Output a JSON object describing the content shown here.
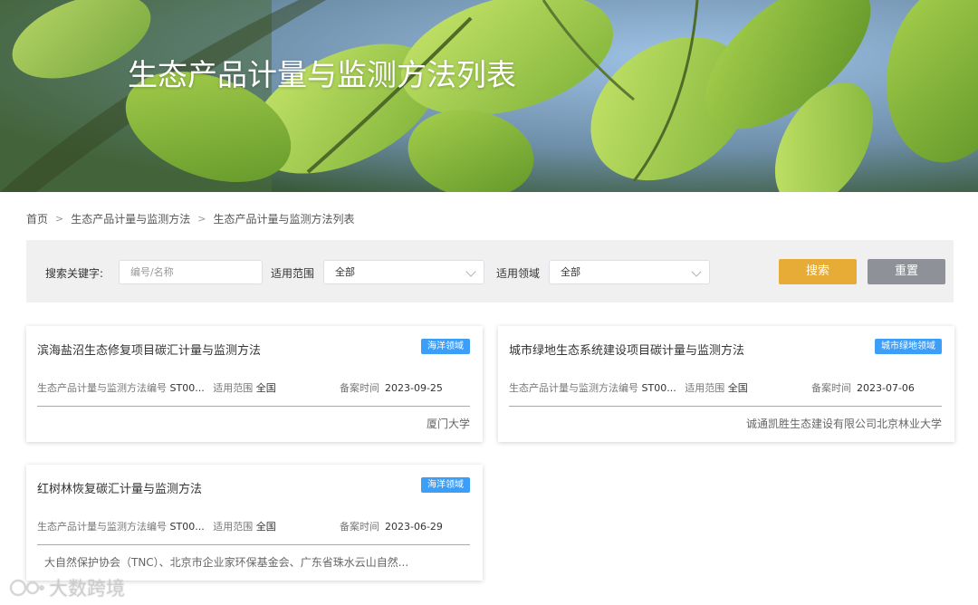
{
  "banner": {
    "title": "生态产品计量与监测方法列表"
  },
  "breadcrumb": {
    "items": [
      "首页",
      "生态产品计量与监测方法",
      "生态产品计量与监测方法列表"
    ]
  },
  "search": {
    "keyword_label": "搜索关键字:",
    "keyword_placeholder": "编号/名称",
    "scope_label": "适用范围",
    "scope_value": "全部",
    "field_label": "适用领域",
    "field_value": "全部",
    "search_button": "搜索",
    "reset_button": "重置"
  },
  "cards": [
    {
      "title": "滨海盐沼生态修复项目碳汇计量与监测方法",
      "tag": "海洋领域",
      "code_label": "生态产品计量与监测方法编号",
      "code_value": "ST00...",
      "scope_label": "适用范围",
      "scope_value": "全国",
      "date_label": "备案时间",
      "date_value": "2023-09-25",
      "org": "厦门大学"
    },
    {
      "title": "城市绿地生态系统建设项目碳计量与监测方法",
      "tag": "城市绿地领域",
      "code_label": "生态产品计量与监测方法编号",
      "code_value": "ST00...",
      "scope_label": "适用范围",
      "scope_value": "全国",
      "date_label": "备案时间",
      "date_value": "2023-07-06",
      "org": "诚通凯胜生态建设有限公司北京林业大学"
    },
    {
      "title": "红树林恢复碳汇计量与监测方法",
      "tag": "海洋领域",
      "code_label": "生态产品计量与监测方法编号",
      "code_value": "ST00...",
      "scope_label": "适用范围",
      "scope_value": "全国",
      "date_label": "备案时间",
      "date_value": "2023-06-29",
      "org": "大自然保护协会（TNC）、北京市企业家环保基金会、广东省珠水云山自然..."
    }
  ],
  "watermark": {
    "text": "大数跨境"
  },
  "colors": {
    "accent": "#e6ac35",
    "reset": "#8e9197",
    "tag": "#3d9ef7"
  },
  "icons": {
    "breadcrumb_separator": "chevron-right-icon",
    "select_arrow": "chevron-down-icon"
  }
}
